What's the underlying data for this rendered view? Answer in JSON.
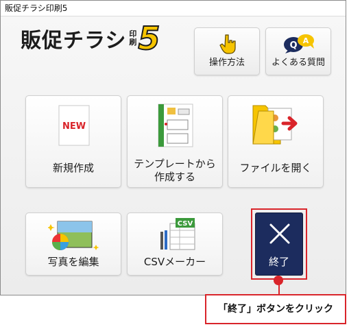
{
  "window": {
    "title": "販促チラシ印刷5"
  },
  "logo": {
    "main": "販促チラシ",
    "small_top": "印",
    "small_bottom": "刷",
    "number": "5"
  },
  "top_buttons": {
    "operation": "操作方法",
    "faq": "よくある質問",
    "faq_badge_q": "Q",
    "faq_badge_a": "A"
  },
  "tiles": {
    "new": {
      "label": "新規作成",
      "badge": "NEW"
    },
    "template": {
      "label_line1": "テンプレートから",
      "label_line2": "作成する"
    },
    "open": {
      "label": "ファイルを開く"
    },
    "photo": {
      "label": "写真を編集"
    },
    "csv": {
      "label": "CSVメーカー",
      "badge": "CSV"
    }
  },
  "exit": {
    "label": "終了"
  },
  "annotation": {
    "text": "「終了」ボタンをクリック"
  },
  "colors": {
    "exit_bg": "#1c2c5e",
    "highlight_red": "#d9242a",
    "logo_yellow": "#f6c400"
  },
  "icons": {
    "operation": "pointing-hand-icon",
    "faq": "qa-bubble-icon",
    "new": "new-document-icon",
    "template": "template-document-icon",
    "open": "open-folder-icon",
    "photo": "photo-edit-icon",
    "csv": "csv-spreadsheet-icon",
    "exit": "close-x-icon"
  }
}
